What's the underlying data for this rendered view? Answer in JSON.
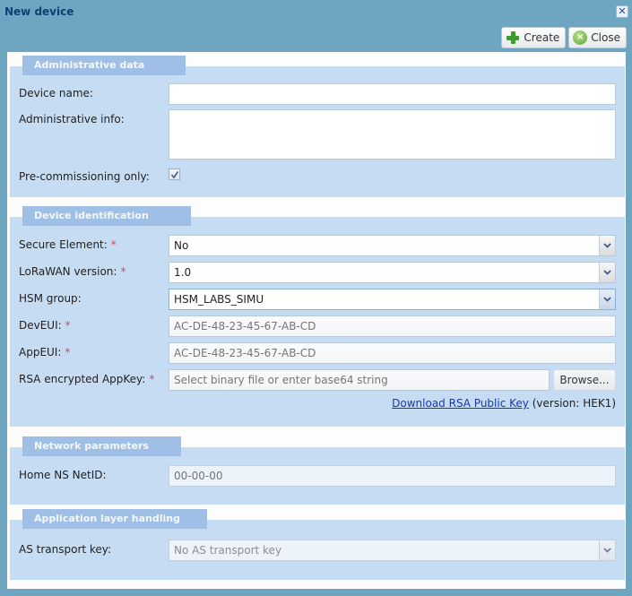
{
  "window": {
    "title": "New device",
    "close_glyph": "✕"
  },
  "toolbar": {
    "create_label": "Create",
    "close_label": "Close",
    "create_icon": "plus-icon",
    "close_icon": "close-circle-icon"
  },
  "sections": {
    "administrative": {
      "title": "Administrative data",
      "device_name_label": "Device name:",
      "device_name_value": "",
      "admin_info_label": "Administrative info:",
      "admin_info_value": "",
      "precommissioning_label": "Pre-commissioning only:",
      "precommissioning_checked": true
    },
    "identification": {
      "title": "Device identification",
      "secure_element_label": "Secure Element:",
      "secure_element_value": "No",
      "lorawan_version_label": "LoRaWAN version:",
      "lorawan_version_value": "1.0",
      "hsm_group_label": "HSM group:",
      "hsm_group_value": "HSM_LABS_SIMU",
      "deveui_label": "DevEUI:",
      "deveui_placeholder": "AC-DE-48-23-45-67-AB-CD",
      "appeui_label": "AppEUI:",
      "appeui_placeholder": "AC-DE-48-23-45-67-AB-CD",
      "appkey_label": "RSA encrypted AppKey:",
      "appkey_placeholder": "Select binary file or enter base64 string",
      "browse_label": "Browse...",
      "download_link": "Download RSA Public Key",
      "version_text": "(version: HEK1)",
      "required_mark": "*"
    },
    "network": {
      "title": "Network parameters",
      "netid_label": "Home NS NetID:",
      "netid_placeholder": "00-00-00"
    },
    "application": {
      "title": "Application layer handling",
      "as_key_label": "AS transport key:",
      "as_key_value": "No AS transport key"
    }
  },
  "colors": {
    "frame": "#6ea6c2",
    "title_text": "#0f3f73",
    "section_bg": "#c5dcf2",
    "section_tab": "#9fbfe6",
    "required": "#e0455a",
    "link": "#1a36b5"
  }
}
